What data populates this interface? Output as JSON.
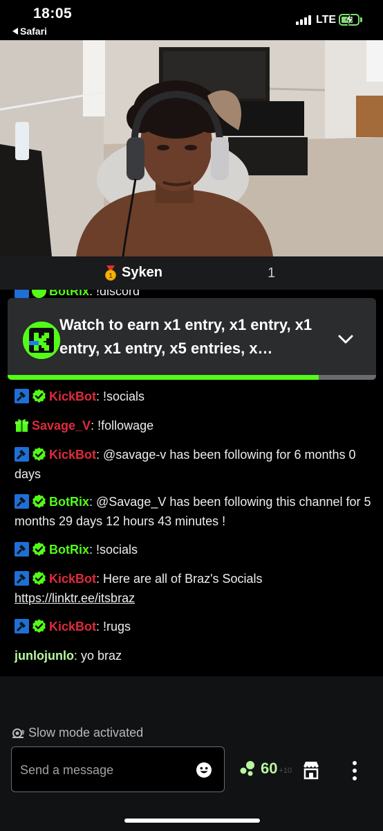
{
  "status_bar": {
    "time": "18:05",
    "back_app": "Safari",
    "network": "LTE",
    "icons": [
      "signal-icon",
      "battery-charging-icon"
    ]
  },
  "video": {
    "description_icon": "live-video"
  },
  "streamer": {
    "name": "Syken",
    "rank_badge_icon": "medal-1-icon",
    "viewer_count": "1"
  },
  "chat": {
    "partial_top": {
      "user": "BotRix",
      "text": ": !discord"
    },
    "messages": [
      {
        "user": "KickBot",
        "user_color": "#e02a3b",
        "badges": [
          "moderator-icon",
          "verified-icon"
        ],
        "text": ": !socials"
      },
      {
        "user": "Savage_V",
        "user_color": "#e02a3b",
        "badges": [
          "gift-icon"
        ],
        "text": ": !followage"
      },
      {
        "user": "KickBot",
        "user_color": "#e02a3b",
        "badges": [
          "moderator-icon",
          "verified-icon"
        ],
        "text": ": @savage-v has been following for 6 months 0 days"
      },
      {
        "user": "BotRix",
        "user_color": "#53fc18",
        "badges": [
          "moderator-icon",
          "verified-icon"
        ],
        "text": ": @Savage_V has been following this channel for 5 months 29 days 12 hours 43 minutes !"
      },
      {
        "user": "BotRix",
        "user_color": "#53fc18",
        "badges": [
          "moderator-icon",
          "verified-icon"
        ],
        "text": ": !socials"
      },
      {
        "user": "KickBot",
        "user_color": "#e02a3b",
        "badges": [
          "moderator-icon",
          "verified-icon"
        ],
        "text": ": Here are all of Braz's Socials ",
        "link": "https://linktr.ee/itsbraz"
      },
      {
        "user": "KickBot",
        "user_color": "#e02a3b",
        "badges": [
          "moderator-icon",
          "verified-icon"
        ],
        "text": ": !rugs"
      },
      {
        "user": "junlojunlo",
        "user_color": "#b9f6a0",
        "badges": [],
        "text": ": yo braz"
      }
    ]
  },
  "promo": {
    "text": "Watch to earn x1 entry, x1 entry, x1 entry, x1 entry, x5 entries, x…",
    "logo_letter": "K",
    "progress": 0.845,
    "expand_icon": "chevron-down-icon"
  },
  "composer": {
    "slow_mode": "Slow mode activated",
    "placeholder": "Send a message",
    "points": "60",
    "points_delta": "+10"
  },
  "colors": {
    "accent": "#53fc18",
    "moderator": "#1e6fd6",
    "danger_user": "#e02a3b"
  }
}
